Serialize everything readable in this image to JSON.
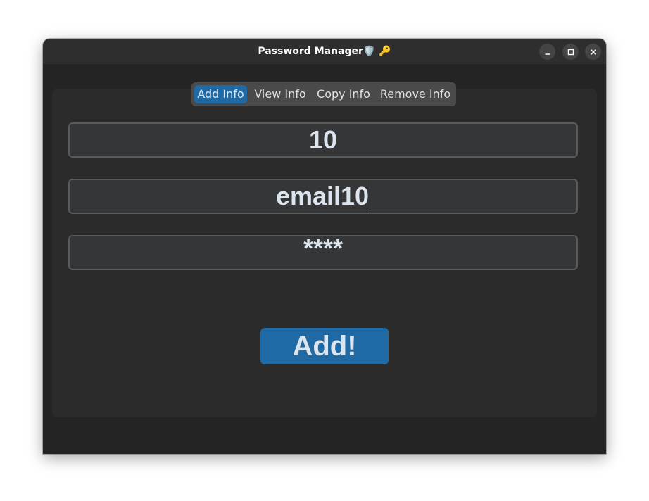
{
  "window": {
    "title": "Password Manager🛡️ 🔑",
    "controls": [
      "minimize-icon",
      "maximize-icon",
      "close-icon"
    ]
  },
  "tabs": [
    {
      "label": "Add Info",
      "active": true
    },
    {
      "label": "View Info",
      "active": false
    },
    {
      "label": "Copy Info",
      "active": false
    },
    {
      "label": "Remove Info",
      "active": false
    }
  ],
  "form": {
    "site_value": "10",
    "email_value": "email10",
    "password_value": "****",
    "submit_label": "Add!"
  },
  "colors": {
    "accent": "#1f6aa5",
    "window_bg": "#242424",
    "panel_bg": "#2b2b2b",
    "field_bg": "#343638",
    "field_border": "#565b5e",
    "text": "#dce4ee"
  }
}
